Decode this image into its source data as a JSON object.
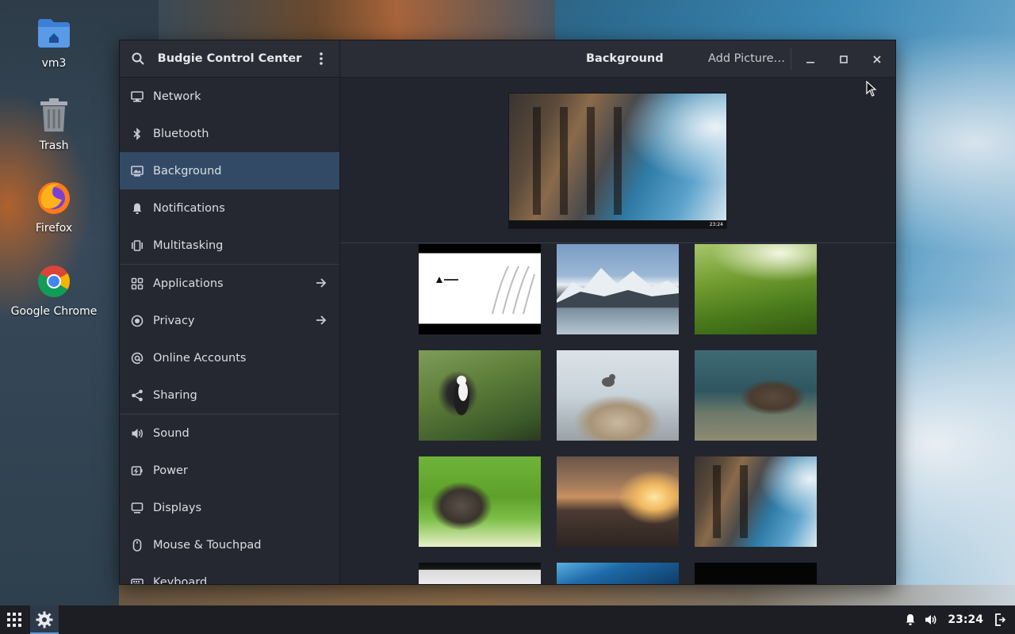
{
  "desktop": {
    "icons": [
      {
        "label": "vm3",
        "icon": "home-folder-icon"
      },
      {
        "label": "Trash",
        "icon": "trash-icon"
      },
      {
        "label": "Firefox",
        "icon": "firefox-icon"
      },
      {
        "label": "Google Chrome",
        "icon": "chrome-icon"
      }
    ]
  },
  "window": {
    "sidebar": {
      "title": "Budgie Control Center",
      "items": [
        {
          "label": "Network",
          "icon": "network-icon"
        },
        {
          "label": "Bluetooth",
          "icon": "bluetooth-icon"
        },
        {
          "label": "Background",
          "icon": "background-icon",
          "selected": true
        },
        {
          "label": "Notifications",
          "icon": "bell-icon"
        },
        {
          "label": "Multitasking",
          "icon": "multitasking-icon"
        },
        {
          "label": "Applications",
          "icon": "applications-icon",
          "arrow": true
        },
        {
          "label": "Privacy",
          "icon": "privacy-icon",
          "arrow": true
        },
        {
          "label": "Online Accounts",
          "icon": "at-icon"
        },
        {
          "label": "Sharing",
          "icon": "share-icon"
        },
        {
          "label": "Sound",
          "icon": "speaker-icon"
        },
        {
          "label": "Power",
          "icon": "power-icon"
        },
        {
          "label": "Displays",
          "icon": "display-icon"
        },
        {
          "label": "Mouse & Touchpad",
          "icon": "mouse-icon"
        },
        {
          "label": "Keyboard",
          "icon": "keyboard-icon"
        }
      ]
    },
    "content": {
      "title": "Background",
      "add_picture_label": "Add Picture…",
      "preview_clock": "23:24",
      "wallpapers": [
        {
          "name": "arch-linux-wallpaper"
        },
        {
          "name": "mountain-lake-wallpaper"
        },
        {
          "name": "green-tea-hills-wallpaper"
        },
        {
          "name": "osprey-bird-wallpaper"
        },
        {
          "name": "bird-on-rock-wallpaper"
        },
        {
          "name": "otter-wallpaper"
        },
        {
          "name": "kitten-grass-wallpaper"
        },
        {
          "name": "city-sunset-wallpaper"
        },
        {
          "name": "colosseum-wallpaper"
        },
        {
          "name": "dark-dome-wallpaper"
        },
        {
          "name": "blue-wallpaper"
        },
        {
          "name": "black-wallpaper"
        }
      ]
    }
  },
  "taskbar": {
    "clock": "23:24"
  },
  "colors": {
    "selected_bg": "#334a67",
    "sidebar_bg": "#252830",
    "content_bg": "#22252e",
    "taskbar_bg": "#1c1e24"
  }
}
